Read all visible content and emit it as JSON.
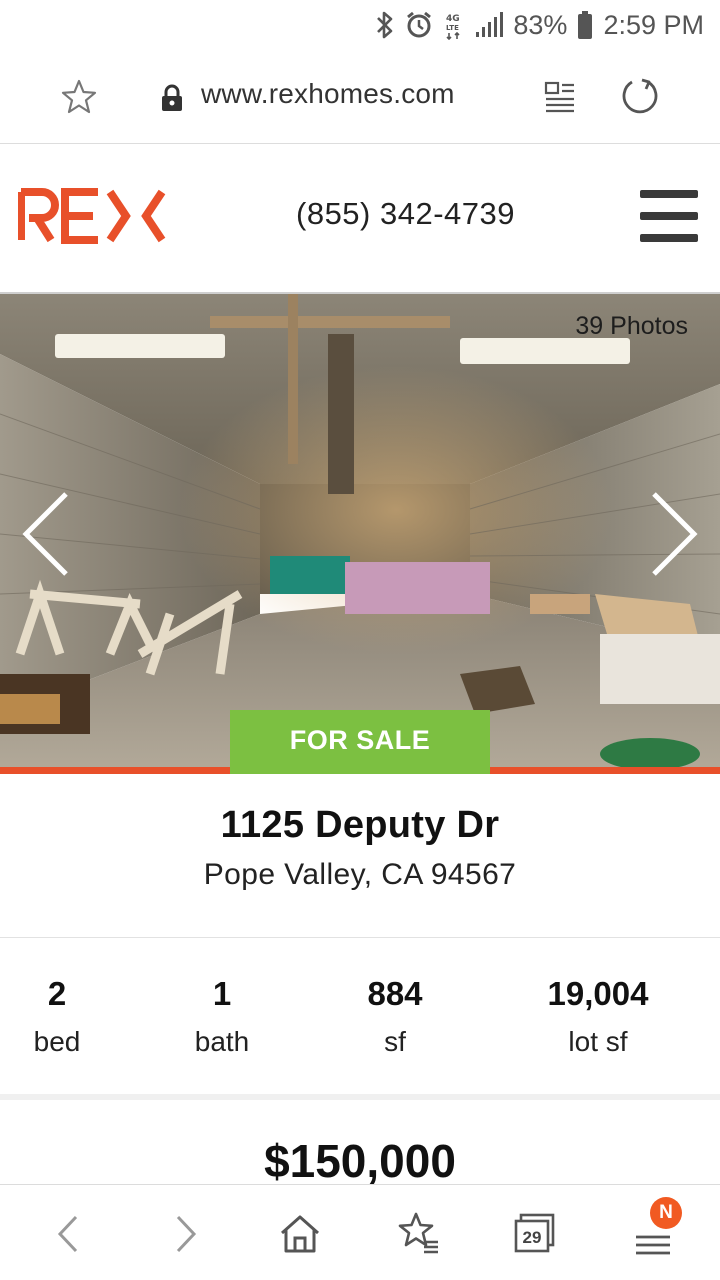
{
  "status_bar": {
    "battery": "83%",
    "time": "2:59 PM",
    "network": "4G LTE"
  },
  "url_bar": {
    "url": "www.rexhomes.com"
  },
  "site_header": {
    "logo_text": "REX",
    "phone": "(855) 342-4739",
    "brand_color": "#e8502a"
  },
  "hero": {
    "photo_count": "39 Photos",
    "badge": "FOR SALE",
    "badge_color": "#7cc041"
  },
  "listing": {
    "street": "1125 Deputy Dr",
    "city_state_zip": "Pope Valley, CA 94567",
    "stats": [
      {
        "value": "2",
        "label": "bed"
      },
      {
        "value": "1",
        "label": "bath"
      },
      {
        "value": "884",
        "label": "sf"
      },
      {
        "value": "19,004",
        "label": "lot sf"
      }
    ],
    "price": "$150,000"
  },
  "bottom_nav": {
    "tab_count": "29",
    "notification_badge": "N"
  }
}
